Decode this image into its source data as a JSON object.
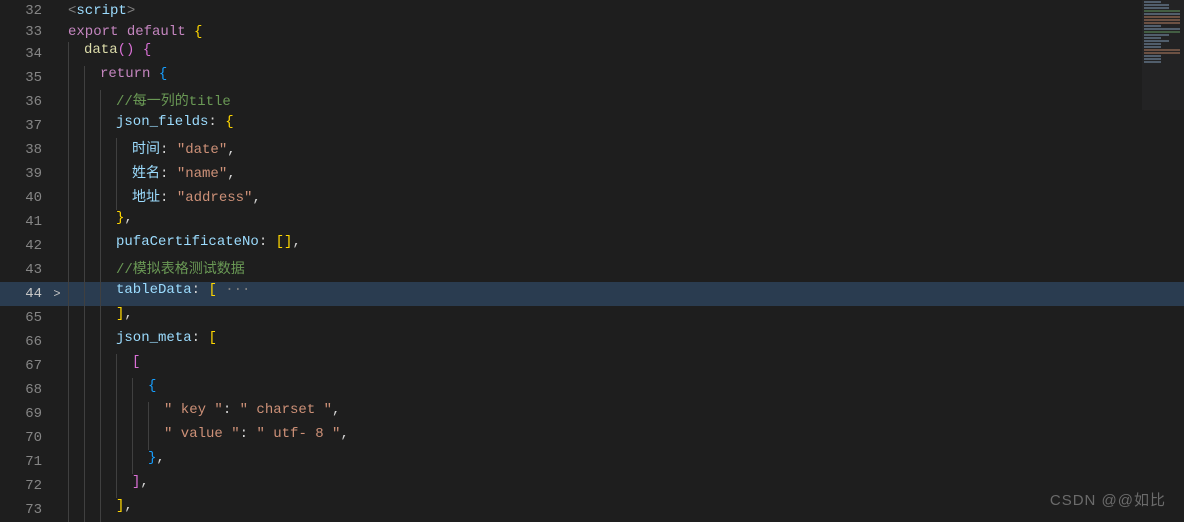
{
  "watermark": "CSDN @@如比",
  "lines": [
    {
      "num": "32",
      "fold": "",
      "current": false,
      "indent": 0,
      "tokens": [
        [
          "tk-tag",
          "<"
        ],
        [
          "tk-prop",
          "script"
        ],
        [
          "tk-tag",
          ">"
        ]
      ]
    },
    {
      "num": "33",
      "fold": "",
      "current": false,
      "indent": 0,
      "tokens": [
        [
          "tk-key",
          "export"
        ],
        [
          "",
          " "
        ],
        [
          "tk-key",
          "default"
        ],
        [
          "",
          " "
        ],
        [
          "tk-brace",
          "{"
        ]
      ]
    },
    {
      "num": "34",
      "fold": "",
      "current": false,
      "indent": 1,
      "tokens": [
        [
          "tk-fn",
          "data"
        ],
        [
          "tk-brace2",
          "()"
        ],
        [
          "",
          " "
        ],
        [
          "tk-brace2",
          "{"
        ]
      ]
    },
    {
      "num": "35",
      "fold": "",
      "current": false,
      "indent": 2,
      "tokens": [
        [
          "tk-key",
          "return"
        ],
        [
          "",
          " "
        ],
        [
          "tk-brace3",
          "{"
        ]
      ]
    },
    {
      "num": "36",
      "fold": "",
      "current": false,
      "indent": 3,
      "tokens": [
        [
          "tk-cmt",
          "//每一列的title"
        ]
      ]
    },
    {
      "num": "37",
      "fold": "",
      "current": false,
      "indent": 3,
      "tokens": [
        [
          "tk-prop",
          "json_fields"
        ],
        [
          "tk-punc",
          ":"
        ],
        [
          "",
          " "
        ],
        [
          "tk-brace",
          "{"
        ]
      ]
    },
    {
      "num": "38",
      "fold": "",
      "current": false,
      "indent": 4,
      "tokens": [
        [
          "tk-prop",
          "时间"
        ],
        [
          "tk-punc",
          ":"
        ],
        [
          "",
          " "
        ],
        [
          "tk-str",
          "\"date\""
        ],
        [
          "tk-punc",
          ","
        ]
      ]
    },
    {
      "num": "39",
      "fold": "",
      "current": false,
      "indent": 4,
      "tokens": [
        [
          "tk-prop",
          "姓名"
        ],
        [
          "tk-punc",
          ":"
        ],
        [
          "",
          " "
        ],
        [
          "tk-str",
          "\"name\""
        ],
        [
          "tk-punc",
          ","
        ]
      ]
    },
    {
      "num": "40",
      "fold": "",
      "current": false,
      "indent": 4,
      "tokens": [
        [
          "tk-prop",
          "地址"
        ],
        [
          "tk-punc",
          ":"
        ],
        [
          "",
          " "
        ],
        [
          "tk-str",
          "\"address\""
        ],
        [
          "tk-punc",
          ","
        ]
      ]
    },
    {
      "num": "41",
      "fold": "",
      "current": false,
      "indent": 3,
      "tokens": [
        [
          "tk-brace",
          "}"
        ],
        [
          "tk-punc",
          ","
        ]
      ]
    },
    {
      "num": "42",
      "fold": "",
      "current": false,
      "indent": 3,
      "tokens": [
        [
          "tk-prop",
          "pufaCertificateNo"
        ],
        [
          "tk-punc",
          ":"
        ],
        [
          "",
          " "
        ],
        [
          "tk-brace",
          "[]"
        ],
        [
          "tk-punc",
          ","
        ]
      ]
    },
    {
      "num": "43",
      "fold": "",
      "current": false,
      "indent": 3,
      "tokens": [
        [
          "tk-cmt",
          "//模拟表格测试数据"
        ]
      ]
    },
    {
      "num": "44",
      "fold": ">",
      "current": true,
      "indent": 3,
      "tokens": [
        [
          "tk-prop",
          "tableData"
        ],
        [
          "tk-punc",
          ":"
        ],
        [
          "",
          " "
        ],
        [
          "tk-brace",
          "["
        ],
        [
          "tk-dots",
          " ···"
        ]
      ]
    },
    {
      "num": "65",
      "fold": "",
      "current": false,
      "indent": 3,
      "tokens": [
        [
          "tk-brace",
          "]"
        ],
        [
          "tk-punc",
          ","
        ]
      ]
    },
    {
      "num": "66",
      "fold": "",
      "current": false,
      "indent": 3,
      "tokens": [
        [
          "tk-prop",
          "json_meta"
        ],
        [
          "tk-punc",
          ":"
        ],
        [
          "",
          " "
        ],
        [
          "tk-brace",
          "["
        ]
      ]
    },
    {
      "num": "67",
      "fold": "",
      "current": false,
      "indent": 4,
      "tokens": [
        [
          "tk-brace2",
          "["
        ]
      ]
    },
    {
      "num": "68",
      "fold": "",
      "current": false,
      "indent": 5,
      "tokens": [
        [
          "tk-brace3",
          "{"
        ]
      ]
    },
    {
      "num": "69",
      "fold": "",
      "current": false,
      "indent": 6,
      "tokens": [
        [
          "tk-str",
          "\" key \""
        ],
        [
          "tk-punc",
          ":"
        ],
        [
          "",
          " "
        ],
        [
          "tk-str",
          "\" charset \""
        ],
        [
          "tk-punc",
          ","
        ]
      ]
    },
    {
      "num": "70",
      "fold": "",
      "current": false,
      "indent": 6,
      "tokens": [
        [
          "tk-str",
          "\" value \""
        ],
        [
          "tk-punc",
          ":"
        ],
        [
          "",
          " "
        ],
        [
          "tk-str",
          "\" utf- 8 \""
        ],
        [
          "tk-punc",
          ","
        ]
      ]
    },
    {
      "num": "71",
      "fold": "",
      "current": false,
      "indent": 5,
      "tokens": [
        [
          "tk-brace3",
          "}"
        ],
        [
          "tk-punc",
          ","
        ]
      ]
    },
    {
      "num": "72",
      "fold": "",
      "current": false,
      "indent": 4,
      "tokens": [
        [
          "tk-brace2",
          "]"
        ],
        [
          "tk-punc",
          ","
        ]
      ]
    },
    {
      "num": "73",
      "fold": "",
      "current": false,
      "indent": 3,
      "tokens": [
        [
          "tk-brace",
          "]"
        ],
        [
          "tk-punc",
          ","
        ]
      ]
    }
  ]
}
